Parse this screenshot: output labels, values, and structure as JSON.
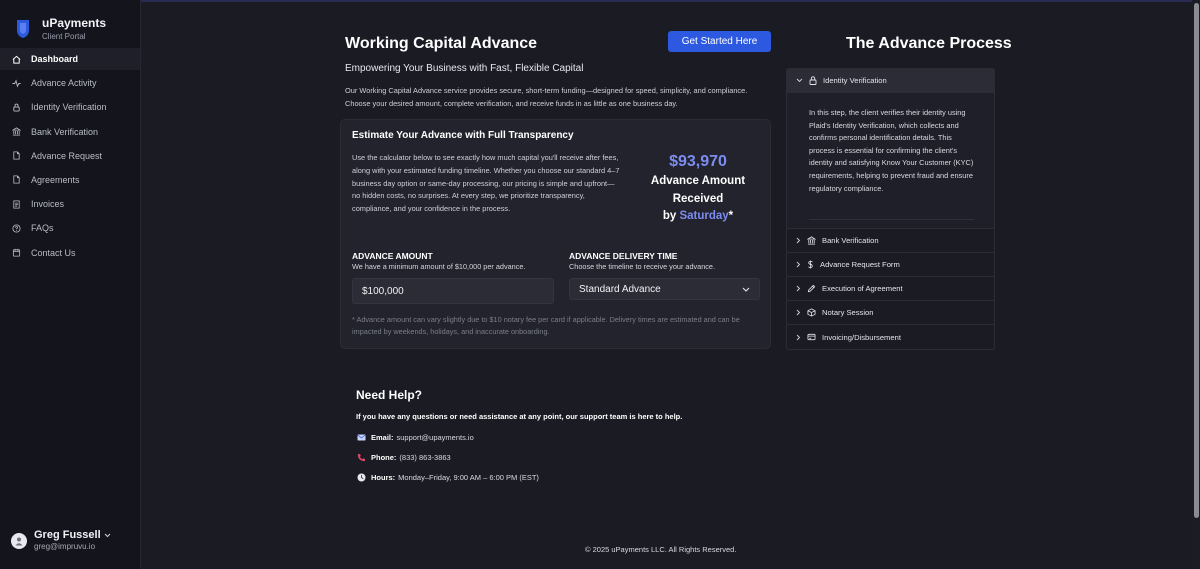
{
  "brand": {
    "name": "uPayments",
    "sub": "Client Portal"
  },
  "nav": [
    {
      "label": "Dashboard",
      "icon": "home-icon",
      "active": true
    },
    {
      "label": "Advance Activity",
      "icon": "activity-icon"
    },
    {
      "label": "Identity Verification",
      "icon": "lock-icon"
    },
    {
      "label": "Bank Verification",
      "icon": "bank-icon"
    },
    {
      "label": "Advance Request",
      "icon": "document-icon"
    },
    {
      "label": "Agreements",
      "icon": "document-icon"
    },
    {
      "label": "Invoices",
      "icon": "invoice-icon"
    },
    {
      "label": "FAQs",
      "icon": "help-circle-icon"
    },
    {
      "label": "Contact Us",
      "icon": "calendar-icon"
    }
  ],
  "user": {
    "name": "Greg Fussell",
    "email": "greg@impruvu.io"
  },
  "main": {
    "title": "Working Capital Advance",
    "cta": "Get Started Here",
    "subtitle": "Empowering Your Business with Fast, Flexible Capital",
    "intro": "Our Working Capital Advance service provides secure, short-term funding—designed for speed, simplicity, and compliance. Choose your desired amount, complete verification, and receive funds in as little as one business day."
  },
  "calc": {
    "title": "Estimate Your Advance with Full Transparency",
    "desc": "Use the calculator below to see exactly how much capital you'll receive after fees, along with your estimated funding timeline. Whether you choose our standard 4–7 business day option or same-day processing, our pricing is simple and upfront—no hidden costs, no surprises. At every step, we prioritize transparency, compliance, and your confidence in the process.",
    "result_amount": "$93,970",
    "result_label": "Advance Amount Received",
    "result_by": "by ",
    "result_day": "Saturday",
    "result_suffix": "*",
    "amount_title": "ADVANCE AMOUNT",
    "amount_hint": "We have a minimum amount of $10,000 per advance.",
    "amount_value": "$100,000",
    "delivery_title": "ADVANCE DELIVERY TIME",
    "delivery_hint": "Choose the timeline to receive your advance.",
    "delivery_value": "Standard Advance",
    "note": "* Advance amount can vary slightly due to $10 notary fee per card if applicable. Delivery times are estimated and can be impacted by weekends, holidays, and inaccurate onboarding."
  },
  "help": {
    "title": "Need Help?",
    "intro": "If you have any questions or need assistance at any point, our support team is here to help.",
    "email_label": "Email:",
    "email_value": "support@upayments.io",
    "phone_label": "Phone:",
    "phone_value": "(833) 863-3863",
    "hours_label": "Hours:",
    "hours_value": "Monday–Friday, 9:00 AM – 6:00 PM (EST)"
  },
  "footer": "© 2025 uPayments LLC. All Rights Reserved.",
  "process": {
    "title": "The Advance Process",
    "steps": [
      {
        "label": "Identity Verification",
        "icon": "lock-icon",
        "open": true
      },
      {
        "label": "Bank Verification",
        "icon": "bank-icon"
      },
      {
        "label": "Advance Request Form",
        "icon": "dollar-icon"
      },
      {
        "label": "Execution of Agreement",
        "icon": "pen-icon"
      },
      {
        "label": "Notary Session",
        "icon": "cube-icon"
      },
      {
        "label": "Invoicing/Disbursement",
        "icon": "invoice-icon"
      }
    ],
    "open_body": "In this step, the client verifies their identity using Plaid's Identity Verification, which collects and confirms personal identification details. This process is essential for confirming the client's identity and satisfying Know Your Customer (KYC) requirements, helping to prevent fraud and ensure regulatory compliance."
  },
  "colors": {
    "accent": "#2d59e0",
    "highlight": "#7d8cf0",
    "background": "#1a1b23",
    "sidebar": "#14151c"
  }
}
